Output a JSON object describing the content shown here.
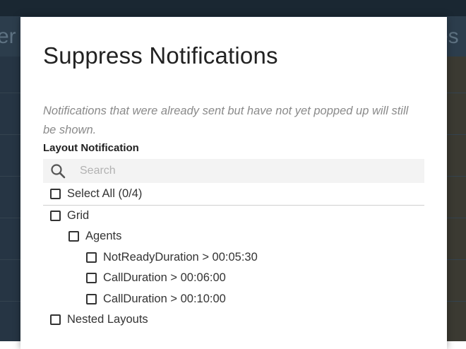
{
  "background": {
    "header_fragment_left": "er",
    "header_fragment_right": "res"
  },
  "dialog": {
    "title": "Suppress Notifications",
    "note": "Notifications that were already sent but have not yet popped up will still be shown.",
    "section_label": "Layout Notification",
    "search": {
      "placeholder": "Search",
      "value": "",
      "icon": "search-icon"
    },
    "select_all_label": "Select All (0/4)",
    "tree": [
      {
        "label": "Grid",
        "level": 0,
        "checked": false
      },
      {
        "label": "Agents",
        "level": 1,
        "checked": false
      },
      {
        "label": "NotReadyDuration > 00:05:30",
        "level": 2,
        "checked": false
      },
      {
        "label": "CallDuration > 00:06:00",
        "level": 2,
        "checked": false
      },
      {
        "label": "CallDuration > 00:10:00",
        "level": 2,
        "checked": false
      },
      {
        "label": "Nested Layouts",
        "level": 0,
        "checked": false
      }
    ]
  },
  "colors": {
    "backdrop": "#1f2a33",
    "modal": "#ffffff",
    "note_text": "#8a8a8a",
    "search_bg": "#f3f3f3"
  }
}
